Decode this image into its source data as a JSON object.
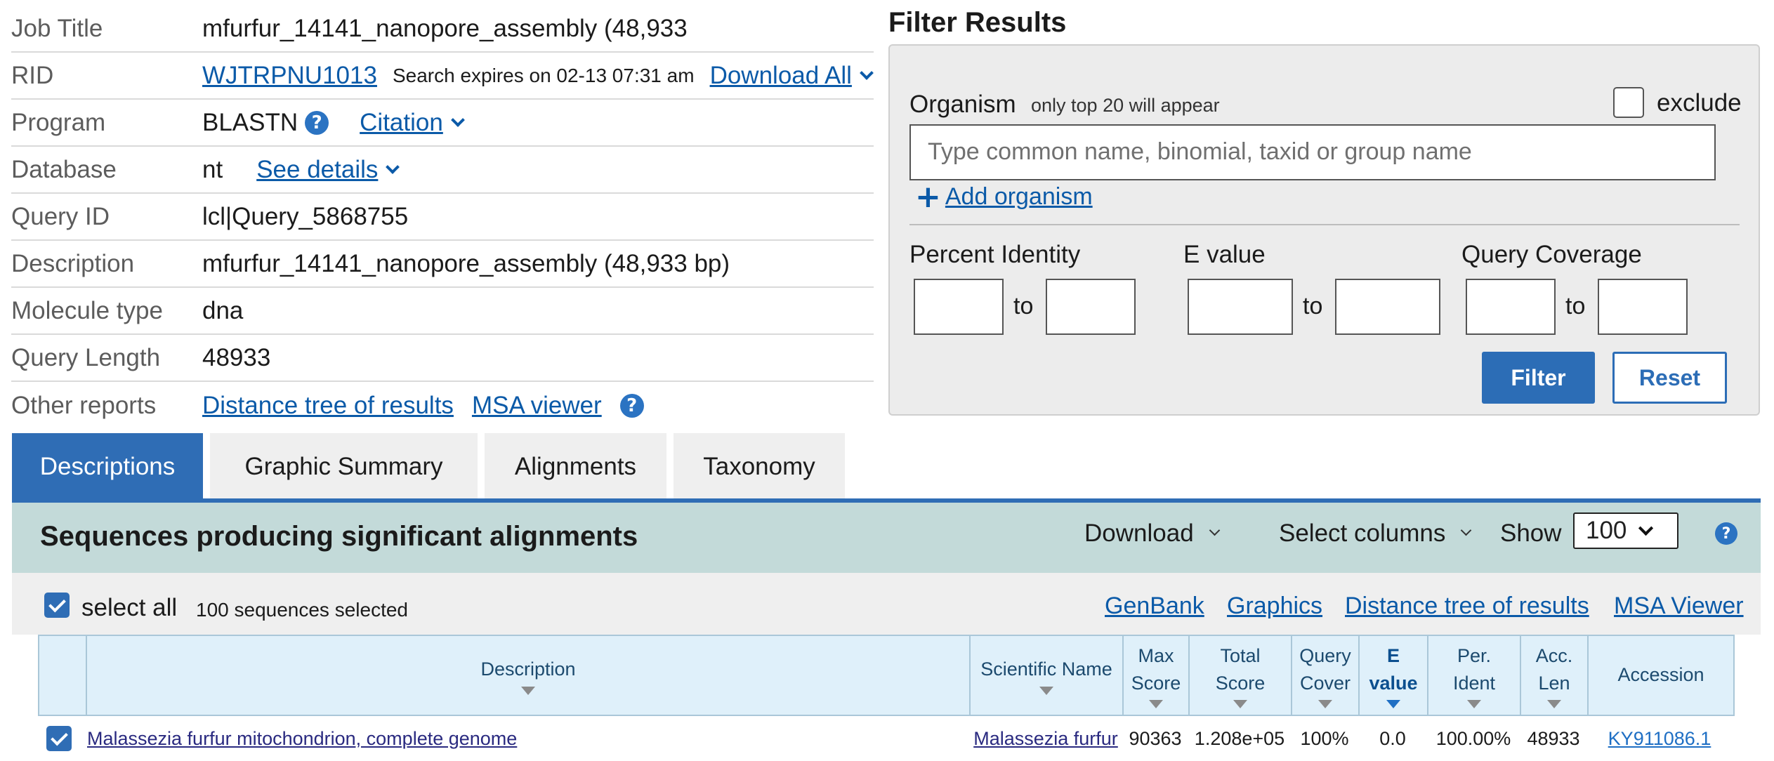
{
  "job_info": {
    "rows": [
      {
        "label": "Job Title",
        "value": "mfurfur_14141_nanopore_assembly (48,933"
      },
      {
        "label": "RID",
        "value": "WJTRPNU1013",
        "note": "Search expires on 02-13 07:31 am",
        "link": "Download All"
      },
      {
        "label": "Program",
        "value": "BLASTN",
        "link": "Citation"
      },
      {
        "label": "Database",
        "value": "nt",
        "link": "See details"
      },
      {
        "label": "Query ID",
        "value": "lcl|Query_5868755"
      },
      {
        "label": "Description",
        "value": "mfurfur_14141_nanopore_assembly (48,933 bp)"
      },
      {
        "label": "Molecule type",
        "value": "dna"
      },
      {
        "label": "Query Length",
        "value": "48933"
      },
      {
        "label": "Other reports",
        "link1": "Distance tree of results",
        "link2": "MSA viewer"
      }
    ],
    "help_glyph": "?"
  },
  "filter": {
    "title": "Filter Results",
    "organism_label": "Organism",
    "organism_note": "only top 20 will appear",
    "exclude_label": "exclude",
    "organism_placeholder": "Type common  name, binomial, taxid or group  name",
    "add_organism": "Add organism",
    "percent_identity_label": "Percent Identity",
    "evalue_label": "E value",
    "query_coverage_label": "Query Coverage",
    "to_label": "to",
    "filter_button": "Filter",
    "reset_button": "Reset"
  },
  "tabs": [
    {
      "label": "Descriptions",
      "active": true
    },
    {
      "label": "Graphic Summary",
      "active": false
    },
    {
      "label": "Alignments",
      "active": false
    },
    {
      "label": "Taxonomy",
      "active": false
    }
  ],
  "results_header": {
    "title": "Sequences producing significant alignments",
    "download": "Download",
    "select_columns": "Select columns",
    "show_label": "Show",
    "show_value": "100",
    "help_glyph": "?"
  },
  "select_bar": {
    "select_all": "select all",
    "selected_count": "100 sequences selected",
    "links": [
      "GenBank",
      "Graphics",
      "Distance tree of results",
      "MSA Viewer"
    ]
  },
  "table": {
    "headers": {
      "description": "Description",
      "scientific_name": "Scientific Name",
      "max_score_1": "Max",
      "max_score_2": "Score",
      "total_score_1": "Total",
      "total_score_2": "Score",
      "query_cover_1": "Query",
      "query_cover_2": "Cover",
      "evalue_1": "E",
      "evalue_2": "value",
      "per_ident_1": "Per.",
      "per_ident_2": "Ident",
      "acc_len_1": "Acc.",
      "acc_len_2": "Len",
      "accession": "Accession"
    },
    "rows": [
      {
        "description": "Malassezia furfur mitochondrion, complete genome",
        "scientific_name": "Malassezia furfur",
        "max_score": "90363",
        "total_score": "1.208e+05",
        "query_cover": "100%",
        "evalue": "0.0",
        "per_ident": "100.00%",
        "acc_len": "48933",
        "accession": "KY911086.1"
      }
    ]
  },
  "colors": {
    "link": "#0b5aa8",
    "tab_active": "#2f6db5",
    "results_header_bg": "#c3dad9",
    "table_header_bg": "#dff0fa"
  }
}
